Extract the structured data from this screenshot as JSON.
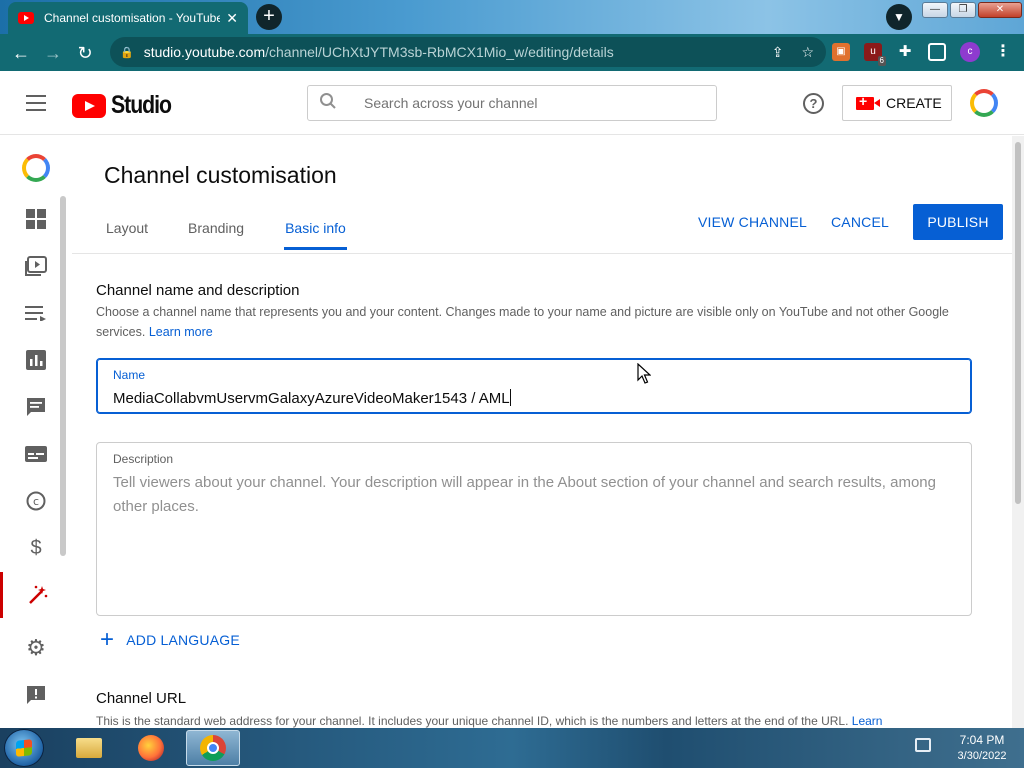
{
  "browser": {
    "tab_title": "Channel customisation - YouTube",
    "tab_close": "✕",
    "new_tab": "+",
    "url_host": "studio.youtube.com",
    "url_path": "/channel/UChXtJYTM3sb-RbMCX1Mio_w/editing/details",
    "ext_badge": "6",
    "profile_letter": "c",
    "window_minimize": "—",
    "window_restore": "❐",
    "window_close": "✕"
  },
  "header": {
    "logo_text": "Studio",
    "search_placeholder": "Search across your channel",
    "help_label": "?",
    "create_label": "CREATE"
  },
  "sidebar": {
    "items": [
      {
        "icon": "dashboard-icon"
      },
      {
        "icon": "content-icon"
      },
      {
        "icon": "playlists-icon"
      },
      {
        "icon": "analytics-icon"
      },
      {
        "icon": "comments-icon"
      },
      {
        "icon": "subtitles-icon"
      },
      {
        "icon": "copyright-icon"
      },
      {
        "icon": "earn-icon"
      },
      {
        "icon": "customisation-icon",
        "active": true
      },
      {
        "icon": "settings-icon"
      },
      {
        "icon": "feedback-icon"
      }
    ]
  },
  "main": {
    "title": "Channel customisation",
    "tabs": [
      {
        "label": "Layout",
        "active": false
      },
      {
        "label": "Branding",
        "active": false
      },
      {
        "label": "Basic info",
        "active": true
      }
    ],
    "actions": {
      "view_channel": "VIEW CHANNEL",
      "cancel": "CANCEL",
      "publish": "PUBLISH"
    },
    "name_section": {
      "heading": "Channel name and description",
      "description": "Choose a channel name that represents you and your content. Changes made to your name and picture are visible only on YouTube and not other Google services.",
      "learn_more": "Learn more"
    },
    "name_field": {
      "label": "Name",
      "value": "MediaCollabvmUservmGalaxyAzureVideoMaker1543 / AML"
    },
    "description_field": {
      "label": "Description",
      "placeholder": "Tell viewers about your channel. Your description will appear in the About section of your channel and search results, among other places."
    },
    "add_language": "ADD LANGUAGE",
    "url_section": {
      "heading": "Channel URL",
      "description": "This is the standard web address for your channel. It includes your unique channel ID, which is the numbers and letters at the end of the URL.",
      "learn_more": "Learn"
    }
  },
  "taskbar": {
    "time": "7:04 PM",
    "date": "3/30/2022"
  },
  "colors": {
    "accent": "#065fd4",
    "brand_red": "#ff0000",
    "browser_teal": "#126a73"
  }
}
